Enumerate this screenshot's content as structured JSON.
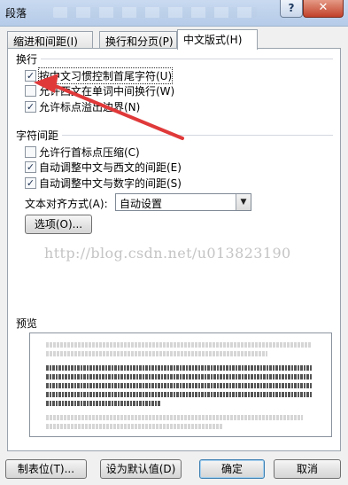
{
  "window": {
    "title": "段落",
    "help_label": "?",
    "close_label": "✕"
  },
  "tabs": [
    {
      "label": "缩进和间距(I)"
    },
    {
      "label": "换行和分页(P)"
    },
    {
      "label": "中文版式(H)"
    }
  ],
  "line_break_group": {
    "title": "换行",
    "options": [
      {
        "label": "按中文习惯控制首尾字符(U)",
        "checked": true
      },
      {
        "label": "允许西文在单词中间换行(W)",
        "checked": false
      },
      {
        "label": "允许标点溢出边界(N)",
        "checked": true
      }
    ]
  },
  "char_spacing_group": {
    "title": "字符间距",
    "options": [
      {
        "label": "允许行首标点压缩(C)",
        "checked": false
      },
      {
        "label": "自动调整中文与西文的间距(E)",
        "checked": true
      },
      {
        "label": "自动调整中文与数字的间距(S)",
        "checked": true
      }
    ],
    "alignment_label": "文本对齐方式(A):",
    "alignment_value": "自动设置",
    "options_button": "选项(O)..."
  },
  "watermark": "http://blog.csdn.net/u013823190",
  "preview": {
    "title": "预览"
  },
  "footer": {
    "tabs_button": "制表位(T)...",
    "default_button": "设为默认值(D)",
    "ok_button": "确定",
    "cancel_button": "取消"
  },
  "colors": {
    "annotation_arrow": "#e0393a"
  }
}
